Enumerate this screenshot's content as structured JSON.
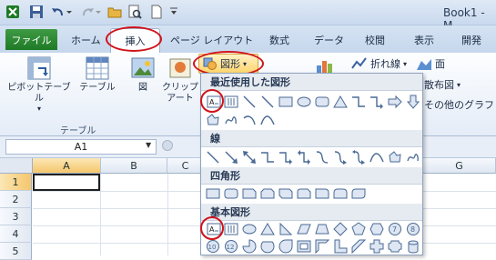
{
  "title_bar": {
    "title": "Book1 - M"
  },
  "tabs": [
    {
      "label": "ファイル"
    },
    {
      "label": "ホーム"
    },
    {
      "label": "挿入"
    },
    {
      "label": "ページ レイアウト"
    },
    {
      "label": "数式"
    },
    {
      "label": "データ"
    },
    {
      "label": "校閲"
    },
    {
      "label": "表示"
    },
    {
      "label": "開発"
    }
  ],
  "ribbon": {
    "pivot_table": "ピボットテーブル",
    "table": "テーブル",
    "picture": "図",
    "clipart_line1": "クリップ",
    "clipart_line2": "アート",
    "table_group": "テーブル",
    "shapes_button": "図形",
    "line_chart": "折れ線",
    "area_chart": "面",
    "scatter_chart": "散布図",
    "other_charts": "その他のグラフ"
  },
  "formula_bar": {
    "name_box": "A1",
    "fx": "fx"
  },
  "sheet": {
    "columns": [
      "A",
      "B",
      "C",
      "G"
    ],
    "rows": [
      "1",
      "2",
      "3",
      "4",
      "5"
    ]
  },
  "shapes_menu": {
    "sections": [
      {
        "title": "最近使用した図形"
      },
      {
        "title": "線"
      },
      {
        "title": "四角形"
      },
      {
        "title": "基本図形"
      }
    ],
    "icon_labels": {
      "text_box": "A",
      "vertical_text_box": "A"
    }
  },
  "colors": {
    "file_tab": "#2a8a30",
    "highlight_ring": "#d0131a",
    "shapes_button": "#ffd66e",
    "shape_fill": "#dde6f2",
    "shape_stroke": "#4a6a95"
  }
}
